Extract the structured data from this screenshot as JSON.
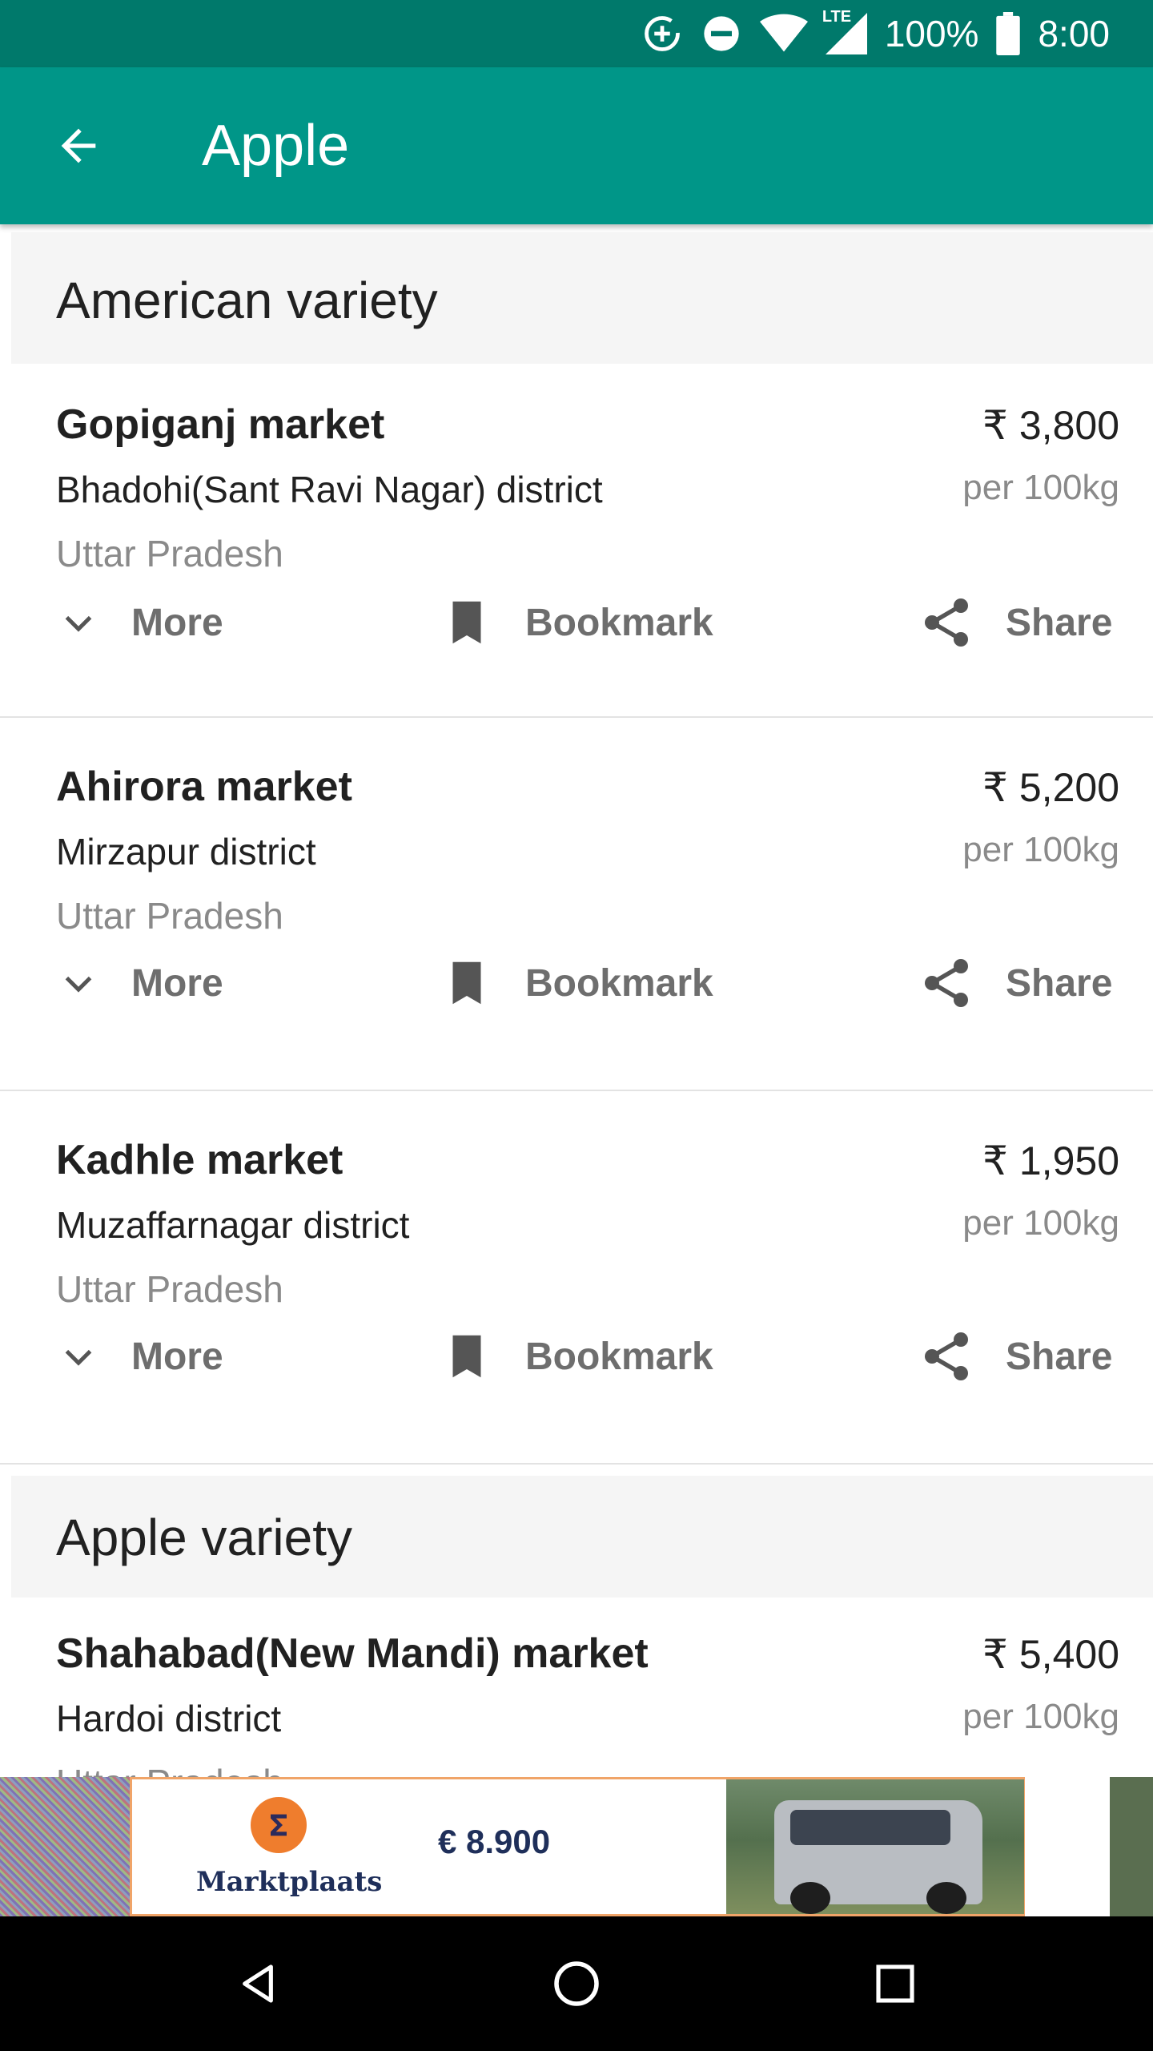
{
  "status_bar": {
    "network": "LTE",
    "battery": "100%",
    "time": "8:00"
  },
  "app_bar": {
    "title": "Apple",
    "back_icon": "arrow-back-icon"
  },
  "sections": [
    {
      "title": "American variety",
      "markets": [
        {
          "name": "Gopiganj market",
          "price": "₹ 3,800",
          "district": "Bhadohi(Sant Ravi Nagar) district",
          "unit": "per 100kg",
          "state": "Uttar Pradesh"
        },
        {
          "name": "Ahirora market",
          "price": "₹ 5,200",
          "district": "Mirzapur district",
          "unit": "per 100kg",
          "state": "Uttar Pradesh"
        },
        {
          "name": "Kadhle market",
          "price": "₹ 1,950",
          "district": "Muzaffarnagar district",
          "unit": "per 100kg",
          "state": "Uttar Pradesh"
        }
      ]
    },
    {
      "title": "Apple variety",
      "markets": [
        {
          "name": "Shahabad(New Mandi) market",
          "price": "₹ 5,400",
          "district": "Hardoi district",
          "unit": "per 100kg",
          "state": "Uttar Pradesh"
        }
      ]
    }
  ],
  "actions": {
    "more": "More",
    "bookmark": "Bookmark",
    "share": "Share"
  },
  "ad": {
    "brand": "Marktplaats",
    "price": "€ 8.900"
  },
  "colors": {
    "status_bar": "#00796b",
    "app_bar": "#009688",
    "ad_border": "#f0a468"
  }
}
